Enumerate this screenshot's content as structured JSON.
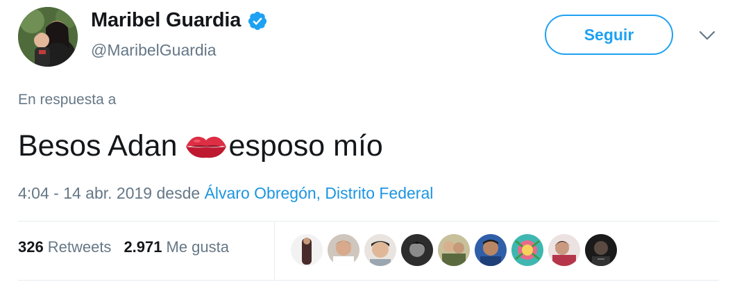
{
  "author": {
    "display_name": "Maribel Guardia",
    "handle": "@MaribelGuardia",
    "verified": true,
    "avatar_icon": "profile-photo"
  },
  "follow_button": {
    "label": "Seguir"
  },
  "menu_icon": "chevron-down-icon",
  "reply_context": "En respuesta a",
  "tweet": {
    "text_before": "Besos Adan",
    "emoji": "kiss-mark-icon",
    "text_after": "esposo mío"
  },
  "meta": {
    "timestamp": "4:04 - 14 abr. 2019",
    "from_word": "desde",
    "place": "Álvaro Obregón, Distrito Federal"
  },
  "stats": {
    "retweets_count": "326",
    "retweets_label": "Retweets",
    "likes_count": "2.971",
    "likes_label": "Me gusta"
  },
  "colors": {
    "accent": "#1da1f2",
    "link": "#1b95e0",
    "secondary_text": "#657786",
    "primary_text": "#14171a",
    "emoji_red": "#e0245e"
  },
  "likers": [
    {
      "icon": "liker-avatar-1"
    },
    {
      "icon": "liker-avatar-2"
    },
    {
      "icon": "liker-avatar-3"
    },
    {
      "icon": "liker-avatar-4"
    },
    {
      "icon": "liker-avatar-5"
    },
    {
      "icon": "liker-avatar-6"
    },
    {
      "icon": "liker-avatar-7"
    },
    {
      "icon": "liker-avatar-8"
    },
    {
      "icon": "liker-avatar-9"
    }
  ]
}
